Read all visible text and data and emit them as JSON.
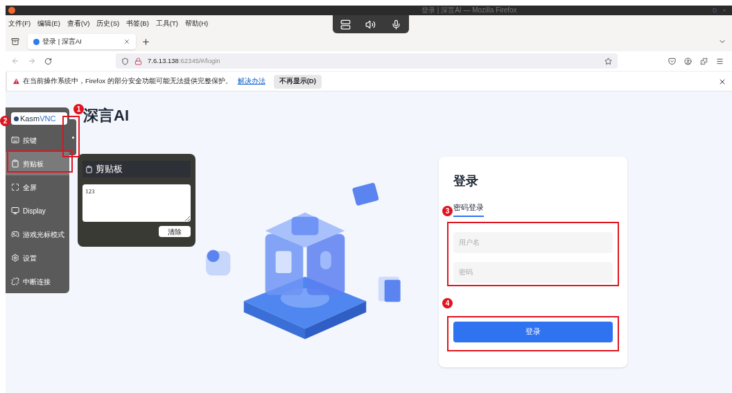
{
  "window": {
    "title": "登录 | 深言AI — Mozilla Firefox"
  },
  "menu": [
    "文件(F)",
    "编辑(E)",
    "查看(V)",
    "历史(S)",
    "书签(B)",
    "工具(T)",
    "帮助(H)"
  ],
  "tabs": [
    {
      "label": "登录 | 深言AI",
      "selected": true
    }
  ],
  "address": {
    "host": "7.6.13.138",
    "rest": ":62345/#/login"
  },
  "notification": {
    "message": "在当前操作系统中，Firefox 的部分安全功能可能无法提供完整保护。",
    "link": "解决办法",
    "button": "不再显示(D)"
  },
  "page": {
    "title": "深言AI",
    "login": {
      "heading": "登录",
      "tabs": [
        {
          "label": "密码登录",
          "selected": true
        }
      ],
      "fields": [
        {
          "placeholder": "用户名"
        },
        {
          "placeholder": "密码"
        }
      ],
      "button": "登录"
    }
  },
  "kasm": {
    "logo": {
      "brand": "Kasm",
      "suffix": "VNC"
    },
    "items": [
      {
        "kind": "keys",
        "label": "按键",
        "selected": false
      },
      {
        "kind": "clipboard",
        "label": "剪贴板",
        "selected": true
      },
      {
        "kind": "fullscreen",
        "label": "全屏",
        "selected": false
      },
      {
        "kind": "display",
        "label": "Display",
        "selected": false
      },
      {
        "kind": "gamepad",
        "label": "游戏光标模式",
        "selected": false
      },
      {
        "kind": "settings",
        "label": "设置",
        "selected": false
      },
      {
        "kind": "disconnect",
        "label": "中断连接",
        "selected": false
      }
    ],
    "clipboard": {
      "title": "剪贴板",
      "value": "123",
      "button": "清除"
    }
  },
  "annotations": [
    "1",
    "2",
    "3",
    "4"
  ]
}
